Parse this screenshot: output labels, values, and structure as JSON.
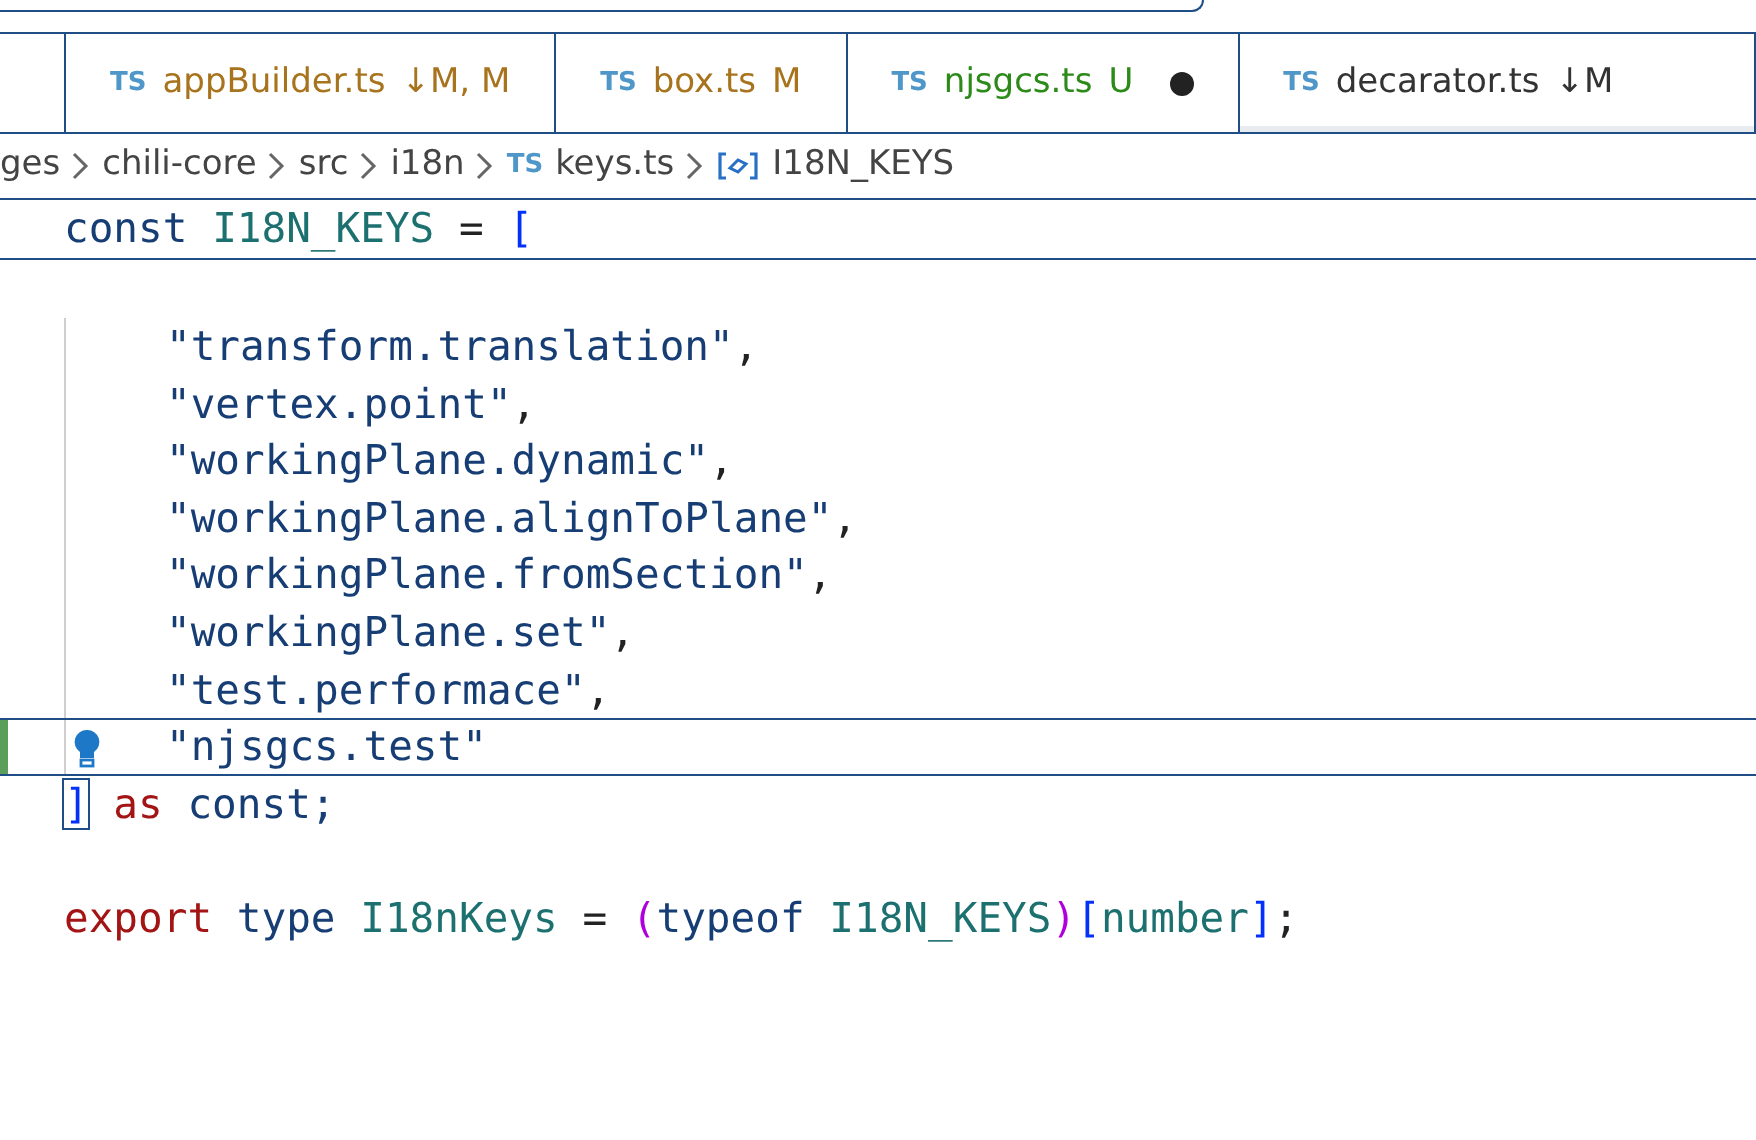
{
  "tabs": [
    {
      "icon": "TS",
      "label": "appBuilder.ts",
      "status": "↓M, M",
      "color": "#a8731d",
      "dirty": false,
      "selected": false
    },
    {
      "icon": "TS",
      "label": "box.ts",
      "status": "M",
      "color": "#a8731d",
      "dirty": false,
      "selected": false
    },
    {
      "icon": "TS",
      "label": "njsgcs.ts",
      "status": "U",
      "color": "#2b8a18",
      "dirty": true,
      "selected": false
    },
    {
      "icon": "TS",
      "label": "decarator.ts",
      "status": "↓M",
      "color": "#333333",
      "dirty": false,
      "selected": true
    }
  ],
  "breadcrumb": [
    {
      "kind": "folder",
      "text": "ges"
    },
    {
      "kind": "folder",
      "text": "chili-core"
    },
    {
      "kind": "folder",
      "text": "src"
    },
    {
      "kind": "folder",
      "text": "i18n"
    },
    {
      "kind": "file",
      "icon": "TS",
      "text": "keys.ts"
    },
    {
      "kind": "symbol",
      "text": "I18N_KEYS"
    }
  ],
  "sticky_line": [
    {
      "kind": "keyword",
      "text": "const "
    },
    {
      "kind": "type",
      "text": "I18N_KEYS"
    },
    {
      "kind": "plain",
      "text": " = "
    },
    {
      "kind": "bracket",
      "text": "["
    }
  ],
  "code_lines": [
    {
      "indent": true,
      "added": false,
      "lightbulb": false,
      "tokens": [
        {
          "kind": "string",
          "text": "\"transform.translation\""
        },
        {
          "kind": "plain",
          "text": ","
        }
      ]
    },
    {
      "indent": true,
      "added": false,
      "lightbulb": false,
      "tokens": [
        {
          "kind": "string",
          "text": "\"vertex.point\""
        },
        {
          "kind": "plain",
          "text": ","
        }
      ]
    },
    {
      "indent": true,
      "added": false,
      "lightbulb": false,
      "tokens": [
        {
          "kind": "string",
          "text": "\"workingPlane.dynamic\""
        },
        {
          "kind": "plain",
          "text": ","
        }
      ]
    },
    {
      "indent": true,
      "added": false,
      "lightbulb": false,
      "tokens": [
        {
          "kind": "string",
          "text": "\"workingPlane.alignToPlane\""
        },
        {
          "kind": "plain",
          "text": ","
        }
      ]
    },
    {
      "indent": true,
      "added": false,
      "lightbulb": false,
      "tokens": [
        {
          "kind": "string",
          "text": "\"workingPlane.fromSection\""
        },
        {
          "kind": "plain",
          "text": ","
        }
      ]
    },
    {
      "indent": true,
      "added": false,
      "lightbulb": false,
      "tokens": [
        {
          "kind": "string",
          "text": "\"workingPlane.set\""
        },
        {
          "kind": "plain",
          "text": ","
        }
      ]
    },
    {
      "indent": true,
      "added": false,
      "lightbulb": false,
      "tokens": [
        {
          "kind": "string",
          "text": "\"test.performace\""
        },
        {
          "kind": "plain",
          "text": ","
        }
      ]
    },
    {
      "indent": true,
      "added": true,
      "lightbulb": true,
      "tokens": [
        {
          "kind": "string",
          "text": "\"njsgcs.test\""
        }
      ]
    },
    {
      "indent": false,
      "added": false,
      "lightbulb": false,
      "tokens": [
        {
          "kind": "bracket",
          "text": "]"
        },
        {
          "kind": "control",
          "text": " as "
        },
        {
          "kind": "keyword",
          "text": "const;"
        }
      ]
    },
    {
      "indent": false,
      "added": false,
      "lightbulb": false,
      "blank_before": true,
      "tokens": [
        {
          "kind": "control",
          "text": "export "
        },
        {
          "kind": "keyword",
          "text": "type "
        },
        {
          "kind": "type",
          "text": "I18nKeys"
        },
        {
          "kind": "plain",
          "text": " = "
        },
        {
          "kind": "paren",
          "text": "("
        },
        {
          "kind": "keyword",
          "text": "typeof "
        },
        {
          "kind": "type",
          "text": "I18N_KEYS"
        },
        {
          "kind": "paren",
          "text": ")"
        },
        {
          "kind": "bracket",
          "text": "["
        },
        {
          "kind": "type",
          "text": "number"
        },
        {
          "kind": "bracket",
          "text": "]"
        },
        {
          "kind": "plain",
          "text": ";"
        }
      ]
    }
  ]
}
